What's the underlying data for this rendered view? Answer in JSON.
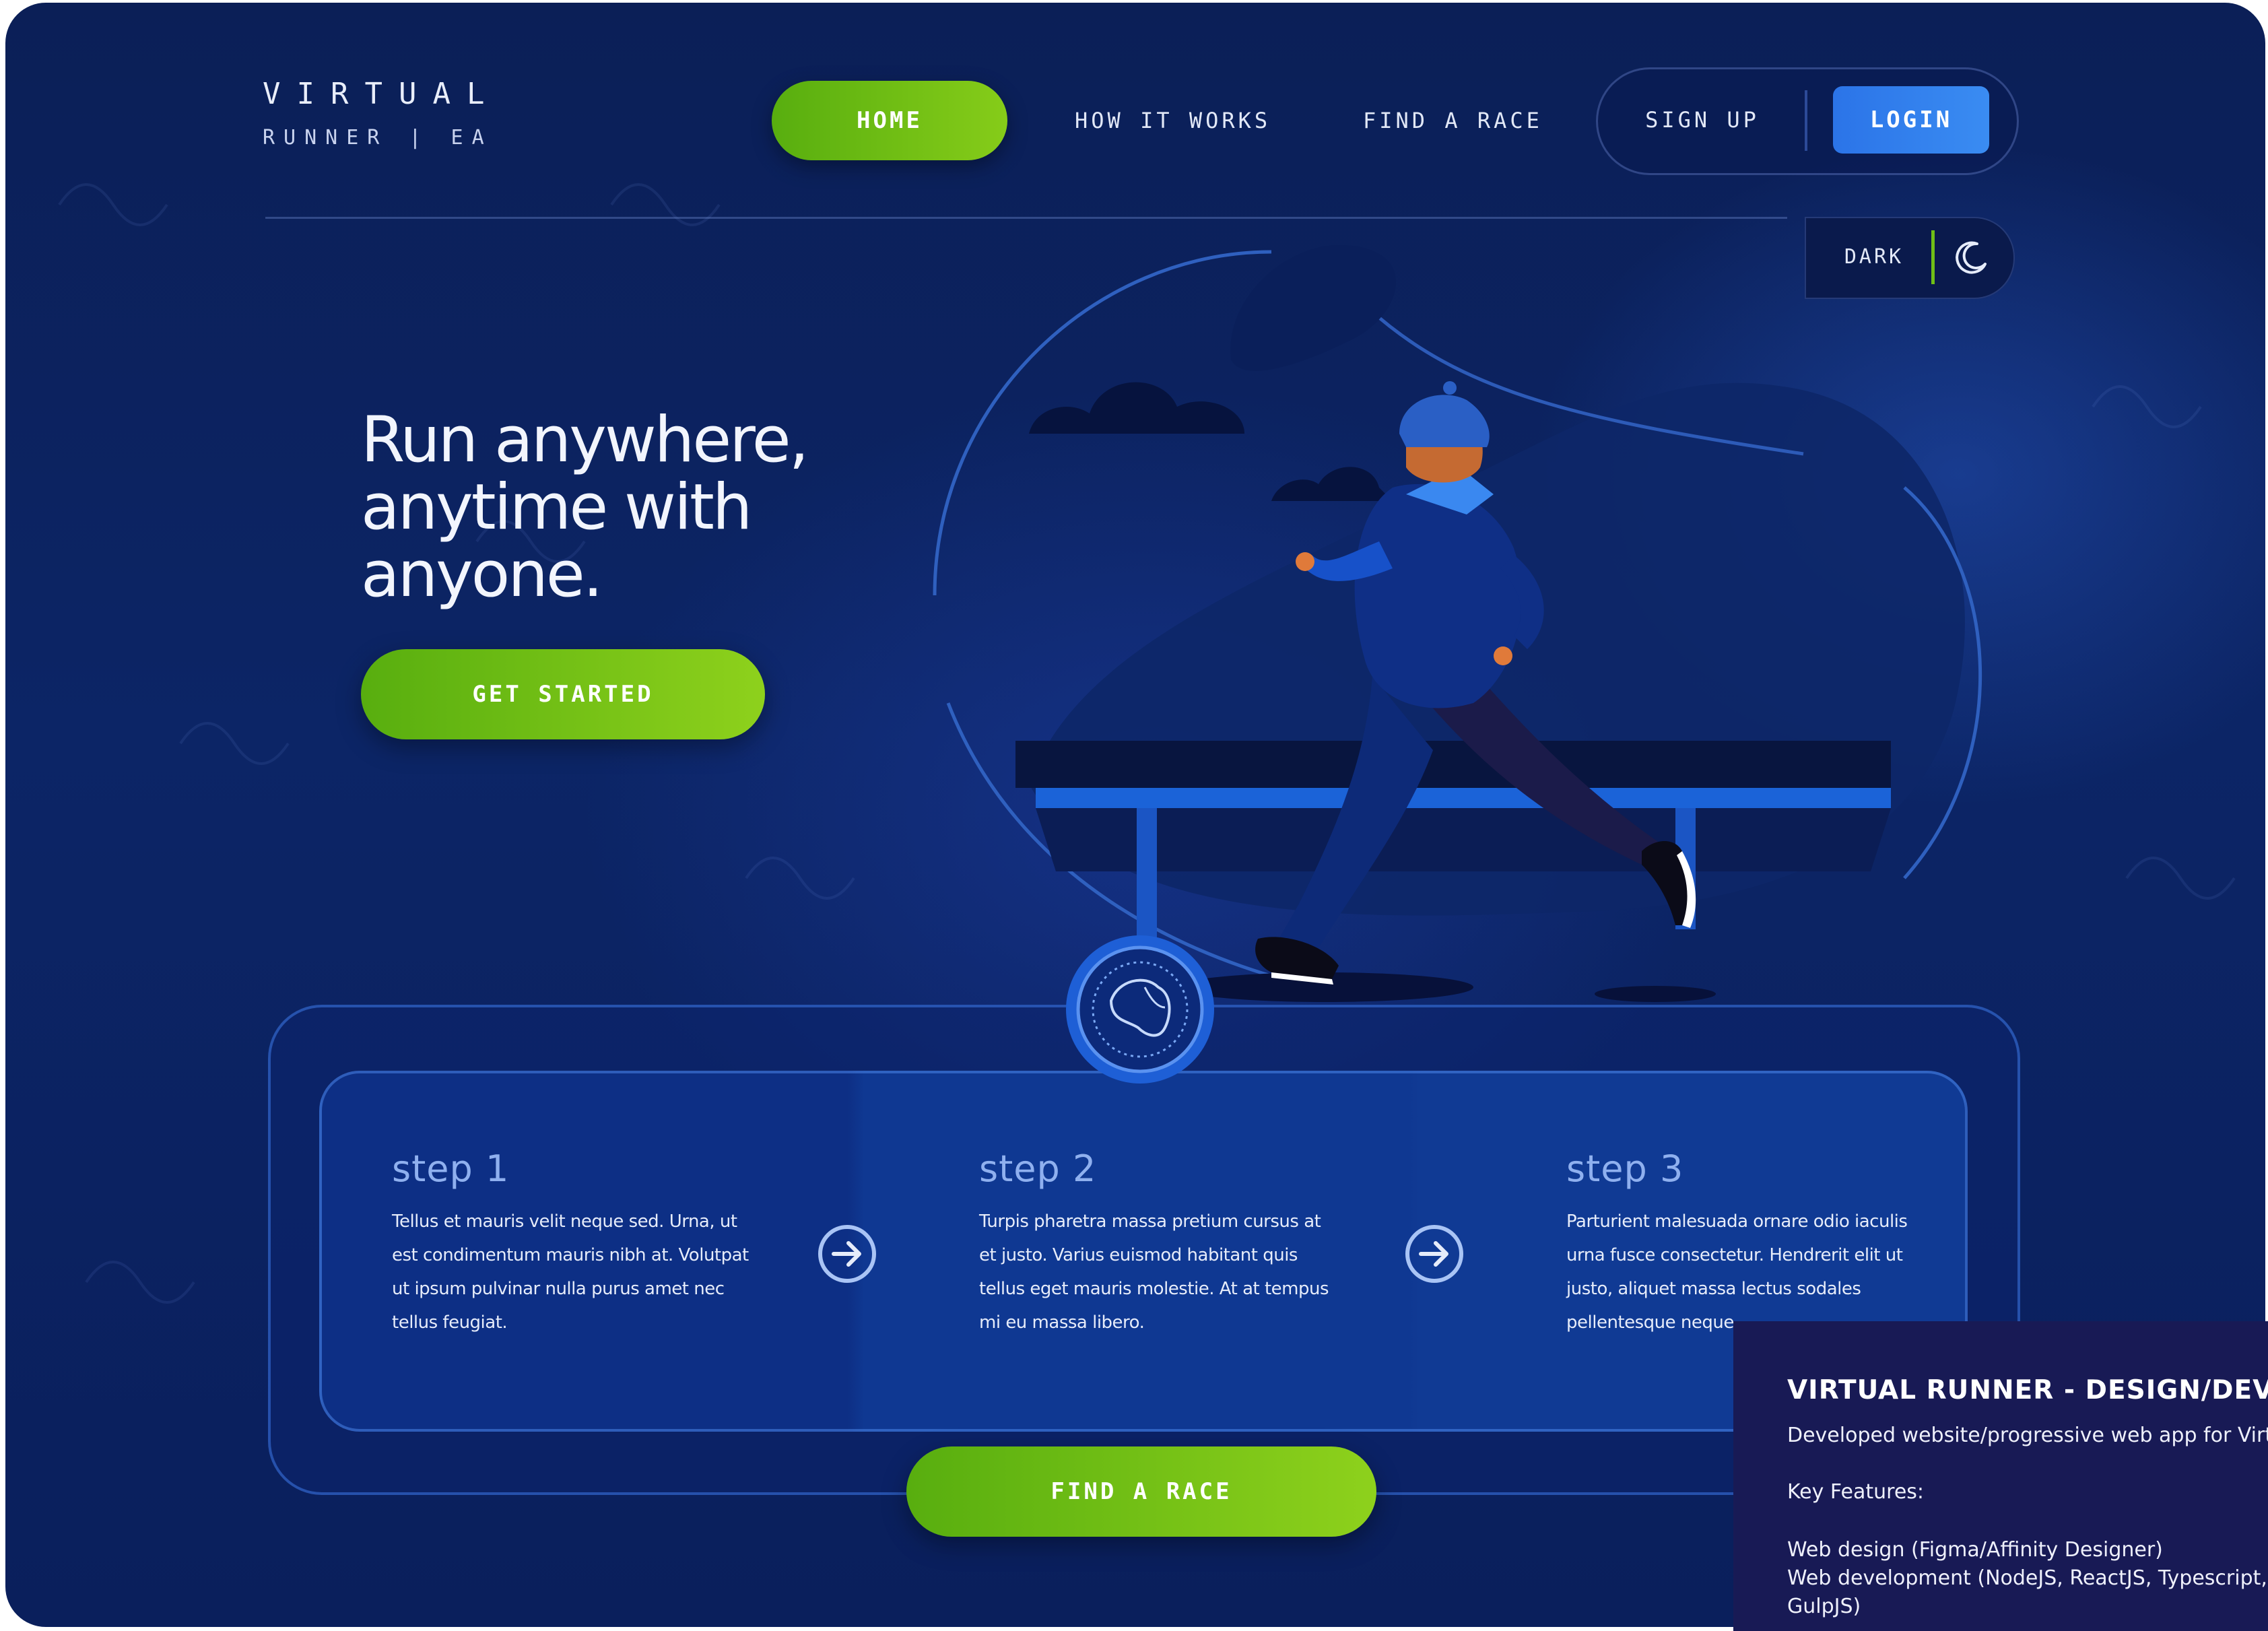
{
  "brand": {
    "line1": "VIRTUAL",
    "line2": "RUNNER | EA"
  },
  "nav": {
    "home": "HOME",
    "how_it_works": "HOW IT WORKS",
    "find_a_race": "FIND A RACE"
  },
  "auth": {
    "signup": "SIGN UP",
    "login": "LOGIN"
  },
  "theme_toggle": {
    "label": "DARK",
    "icon": "moon-icon"
  },
  "hero": {
    "title_lines": [
      "Run anywhere,",
      "anytime with",
      "anyone."
    ],
    "cta": "GET STARTED"
  },
  "steps": [
    {
      "title": "step 1",
      "lines": [
        "Tellus et mauris velit neque sed. Urna, ut",
        "est condimentum mauris nibh at. Volutpat",
        "ut ipsum pulvinar nulla purus amet nec",
        "tellus feugiat."
      ]
    },
    {
      "title": "step 2",
      "lines": [
        "Turpis pharetra massa pretium cursus at",
        "et justo. Varius euismod habitant quis",
        "tellus eget mauris molestie. At at tempus",
        "mi eu massa libero."
      ]
    },
    {
      "title": "step 3",
      "lines": [
        "Parturient malesuada ornare odio iaculis",
        "urna fusce consectetur. Hendrerit elit ut",
        "justo, aliquet massa lectus sodales",
        "pellentesque neque."
      ]
    }
  ],
  "step_arrow_icon": "arrow-right-circle-icon",
  "find_race_cta": "FIND A RACE",
  "info_panel": {
    "title": "VIRTUAL RUNNER - DESIGN/DEVELO",
    "description": "Developed website/progressive web app for Virtual",
    "features_heading": "Key Features:",
    "features": [
      "Web design (Figma/Affinity Designer)",
      "Web development (NodeJS, ReactJS, Typescript, Ta",
      "GulpJS)"
    ]
  },
  "colors": {
    "background": "#0c2566",
    "accent_green": "#6fbf16",
    "accent_blue": "#2b74e8",
    "panel": "#181a55"
  }
}
